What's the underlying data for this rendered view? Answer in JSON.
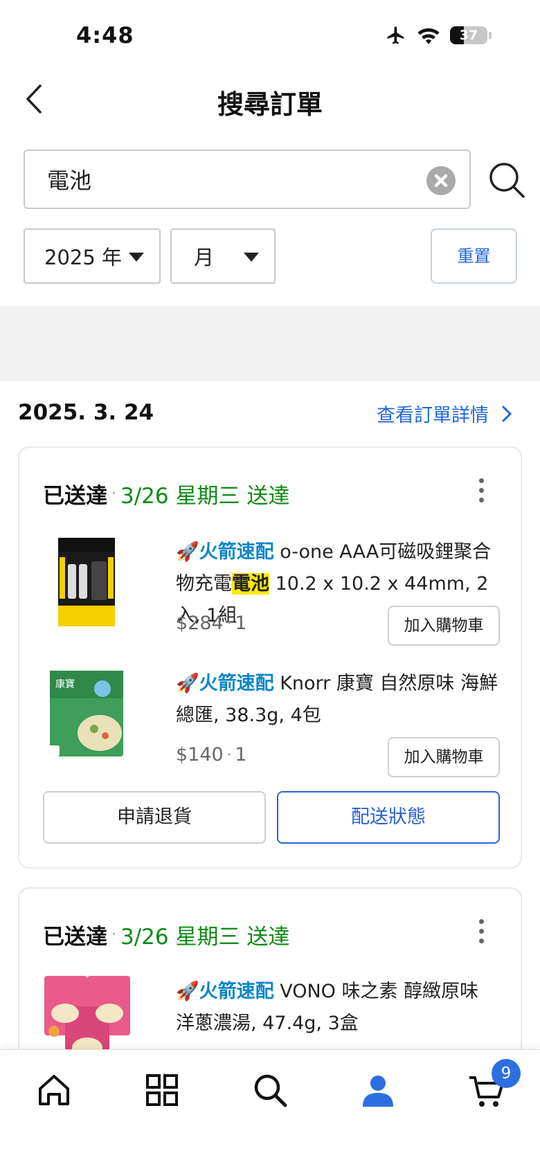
{
  "status_bar": {
    "time": "4:48",
    "battery": "37"
  },
  "header": {
    "title": "搜尋訂單"
  },
  "search": {
    "query": "電池"
  },
  "filters": {
    "year": "2025 年",
    "month": "月",
    "reset": "重置"
  },
  "order": {
    "date": "2025. 3. 24",
    "detail_link": "查看訂單詳情",
    "cards": [
      {
        "status": "已送達",
        "eta": "3/26 星期三 送達",
        "items": [
          {
            "badge": "🚀火箭速配",
            "name_pre": " o-one AAA可磁吸鋰聚合物充電",
            "name_hl": "電池",
            "name_post": " 10.2 x 10.2 x 44mm, 2入, 1組",
            "price": "$284",
            "qty": "1",
            "add_cart": "加入購物車"
          },
          {
            "badge": "🚀火箭速配",
            "name_pre": " Knorr 康寶 自然原味 海鮮總匯, 38.3g, 4包",
            "name_hl": "",
            "name_post": "",
            "price": "$140",
            "qty": "1",
            "add_cart": "加入購物車"
          }
        ],
        "return_btn": "申請退貨",
        "track_btn": "配送狀態"
      },
      {
        "status": "已送達",
        "eta": "3/26 星期三 送達",
        "items": [
          {
            "badge": "🚀火箭速配",
            "name_pre": " VONO 味之素 醇緻原味 洋蔥濃湯, 47.4g, 3盒",
            "name_hl": "",
            "name_post": ""
          }
        ]
      }
    ]
  },
  "bottom_nav": {
    "cart_count": "9"
  },
  "colors": {
    "accent": "#2b62d8",
    "delivered": "#0e8a16",
    "rocket": "#0d86c9",
    "highlight": "#ffea00"
  }
}
